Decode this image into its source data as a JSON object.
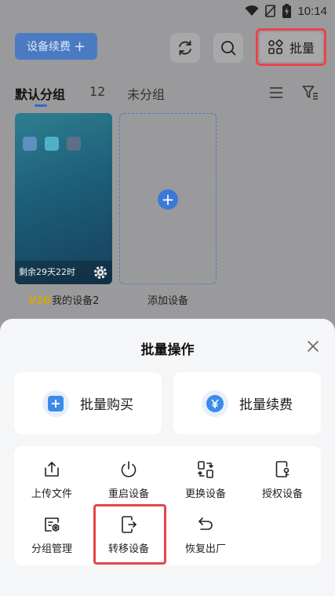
{
  "status_bar": {
    "time": "10:14"
  },
  "toolbar": {
    "renew_label": "设备续费",
    "renew_plus": "+",
    "batch_label": "批量"
  },
  "tabs": {
    "default_group": "默认分组",
    "default_count": "12",
    "ungrouped": "未分组"
  },
  "devices": [
    {
      "remaining": "剩余29天22时",
      "vip": "V10",
      "name": "我的设备2"
    }
  ],
  "add_device": {
    "plus": "+",
    "label": "添加设备"
  },
  "sheet": {
    "title": "批量操作",
    "buy_label": "批量购买",
    "renew_label": "批量续费",
    "operations": [
      {
        "label": "上传文件",
        "icon": "upload-icon"
      },
      {
        "label": "重启设备",
        "icon": "power-icon"
      },
      {
        "label": "更换设备",
        "icon": "swap-device-icon"
      },
      {
        "label": "授权设备",
        "icon": "authorize-icon"
      },
      {
        "label": "分组管理",
        "icon": "group-manage-icon"
      },
      {
        "label": "转移设备",
        "icon": "transfer-icon"
      },
      {
        "label": "恢复出厂",
        "icon": "factory-reset-icon"
      }
    ]
  },
  "colors": {
    "accent": "#2b6bd6",
    "highlight": "#e8444a",
    "overlay": "#9a9a9c"
  }
}
